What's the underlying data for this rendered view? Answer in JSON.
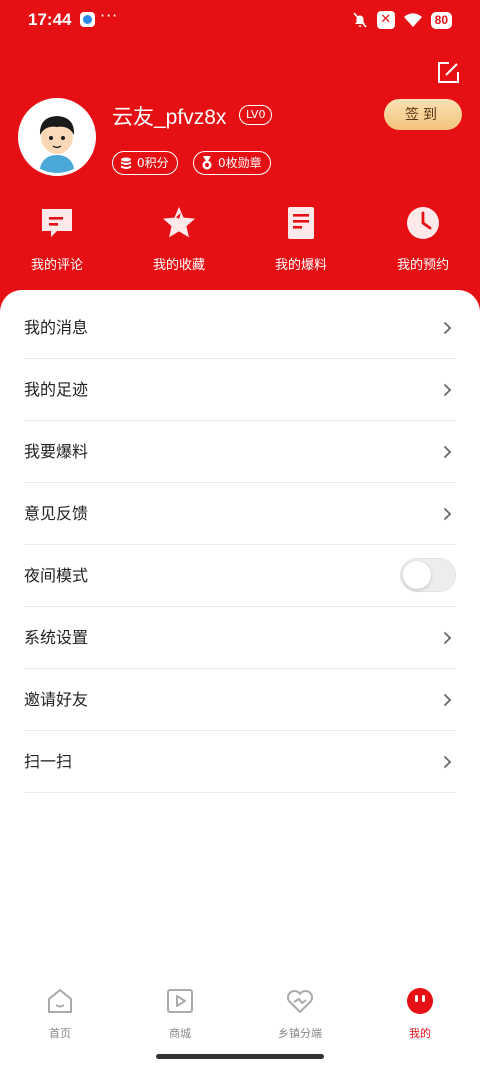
{
  "status_bar": {
    "time": "17:44",
    "dots": "···",
    "x_badge": "✕",
    "battery": "80"
  },
  "profile": {
    "username": "云友_pfvz8x",
    "level": "LV0",
    "points": "0积分",
    "badges": "0枚勋章",
    "checkin_label": "签到"
  },
  "quick_actions": [
    {
      "label": "我的评论",
      "icon": "comment-icon"
    },
    {
      "label": "我的收藏",
      "icon": "star-icon"
    },
    {
      "label": "我的爆料",
      "icon": "document-icon"
    },
    {
      "label": "我的预约",
      "icon": "clock-icon"
    }
  ],
  "menu": [
    {
      "label": "我的消息"
    },
    {
      "label": "我的足迹"
    },
    {
      "label": "我要爆料"
    },
    {
      "label": "意见反馈"
    },
    {
      "label": "夜间模式",
      "toggle": false
    },
    {
      "label": "系统设置"
    },
    {
      "label": "邀请好友"
    },
    {
      "label": "扫一扫"
    }
  ],
  "tabs": [
    {
      "label": "首页",
      "icon": "home-icon",
      "active": false
    },
    {
      "label": "商城",
      "icon": "play-icon",
      "active": false
    },
    {
      "label": "乡镇分端",
      "icon": "heart-hands-icon",
      "active": false
    },
    {
      "label": "我的",
      "icon": "profile-face-icon",
      "active": true
    }
  ],
  "colors": {
    "brand_red": "#e60f14",
    "checkin_gold": "#f2c27a",
    "inactive_tab": "#888888"
  }
}
